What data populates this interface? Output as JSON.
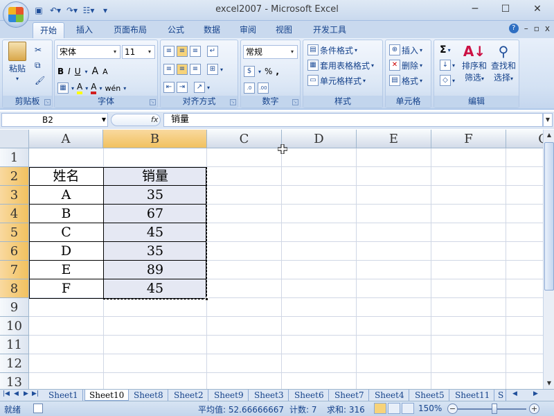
{
  "window": {
    "title": "excel2007 - Microsoft Excel",
    "minimize": "─",
    "maximize": "☐",
    "close": "✕"
  },
  "qat": {
    "save_icon": "save-icon",
    "undo_icon": "undo-icon",
    "redo_icon": "redo-icon",
    "custom_icon": "form-icon",
    "customize": "▾"
  },
  "tabs": [
    "开始",
    "插入",
    "页面布局",
    "公式",
    "数据",
    "审阅",
    "视图",
    "开发工具"
  ],
  "ribbon_right": {
    "help": "?",
    "min": "–",
    "restore": "▫",
    "close": "x"
  },
  "ribbon": {
    "clipboard": {
      "paste": "粘贴",
      "label": "剪贴板"
    },
    "font": {
      "name": "宋体",
      "size": "11",
      "bold": "B",
      "italic": "I",
      "underline": "U",
      "grow": "A",
      "shrink": "A",
      "fill": "A",
      "fontcolor": "A",
      "phonetic": "wén",
      "label": "字体"
    },
    "align": {
      "label": "对齐方式"
    },
    "number": {
      "format": "常规",
      "percent": "%",
      "comma": ",",
      "inc": "+.0\n.00",
      "dec": ".00\n→.0",
      "label": "数字"
    },
    "styles": {
      "cond": "条件格式",
      "table": "套用表格格式",
      "cell": "单元格样式",
      "label": "样式"
    },
    "cells": {
      "insert": "插入",
      "delete": "删除",
      "format": "格式",
      "label": "单元格"
    },
    "editing": {
      "sum": "Σ",
      "sort": "排序和",
      "sort2": "筛选",
      "find": "查找和",
      "find2": "选择",
      "label": "编辑"
    }
  },
  "formula_bar": {
    "name_box": "B2",
    "fx": "fx",
    "content": "销量"
  },
  "grid": {
    "columns": [
      "A",
      "B",
      "C",
      "D",
      "E",
      "F",
      "G"
    ],
    "rows": [
      "1",
      "2",
      "3",
      "4",
      "5",
      "6",
      "7",
      "8",
      "9",
      "10",
      "11",
      "12",
      "13"
    ],
    "header": {
      "a": "姓名",
      "b": "销量"
    },
    "data": [
      {
        "name": "A",
        "sales": "35"
      },
      {
        "name": "B",
        "sales": "67"
      },
      {
        "name": "C",
        "sales": "45"
      },
      {
        "name": "D",
        "sales": "35"
      },
      {
        "name": "E",
        "sales": "89"
      },
      {
        "name": "F",
        "sales": "45"
      }
    ]
  },
  "sheets": [
    "Sheet1",
    "Sheet10",
    "Sheet8",
    "Sheet2",
    "Sheet9",
    "Sheet3",
    "Sheet6",
    "Sheet7",
    "Sheet4",
    "Sheet5",
    "Sheet11",
    "S"
  ],
  "active_sheet": "Sheet10",
  "status": {
    "ready": "就绪",
    "average": "平均值: 52.66666667",
    "count": "计数: 7",
    "sum": "求和: 316",
    "zoom": "150%"
  }
}
